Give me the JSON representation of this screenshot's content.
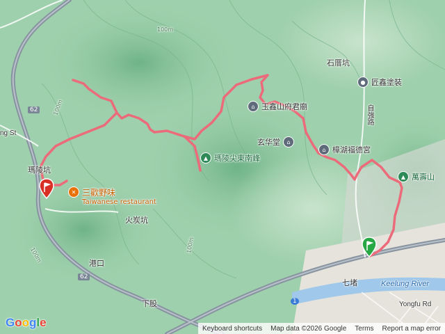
{
  "map": {
    "colors": {
      "route": "#ec6b7a",
      "start": "#28a745",
      "end": "#d93025",
      "terrain": "#9fd0ad",
      "river": "#9fc8ea"
    },
    "place_labels": [
      {
        "key": "shiqi",
        "text": "石厝坑"
      },
      {
        "key": "malingkeng",
        "text": "瑪陵坑"
      },
      {
        "key": "huotan",
        "text": "火炭坑"
      },
      {
        "key": "gangkou",
        "text": "港口"
      },
      {
        "key": "xiagu",
        "text": "下股"
      },
      {
        "key": "qidu",
        "text": "七堵"
      },
      {
        "key": "road_zq",
        "text": "自強路"
      }
    ],
    "contours": [
      "100m",
      "100m",
      "100m",
      "100m"
    ],
    "pois": [
      {
        "key": "jiangxin",
        "text": "匠鑫塗裝",
        "icon": "pin-icon",
        "color": "#5f6b7a"
      },
      {
        "key": "xuanhua",
        "text": "玄华堂",
        "icon": "temple-icon",
        "color": "#5f6b7a"
      },
      {
        "key": "zhanghu",
        "text": "樟湖福德宮",
        "icon": "temple-icon",
        "color": "#5f6b7a"
      },
      {
        "key": "yuxin",
        "text": "玉鑫山府君廟",
        "icon": "temple-icon",
        "color": "#5f6b7a"
      },
      {
        "key": "maling_peak",
        "text": "瑪陵尖東南峰",
        "icon": "park-icon",
        "color": "#2e8b57"
      },
      {
        "key": "wanshou",
        "text": "萬壽山",
        "icon": "park-icon",
        "color": "#2e8b57"
      },
      {
        "key": "sangeyewei",
        "text": "三歡野味",
        "subtext": "Taiwanese restaurant",
        "icon": "restaurant-icon",
        "color": "#e8710a"
      }
    ],
    "road_shields": [
      "62",
      "62",
      "1"
    ],
    "english_labels": [
      "Keelung River",
      "Yongfu Rd",
      "ng St"
    ],
    "footer": {
      "keyboard": "Keyboard shortcuts",
      "data": "Map data ©2026 Google",
      "terms": "Terms",
      "report": "Report a map error"
    },
    "logo": "Google"
  }
}
